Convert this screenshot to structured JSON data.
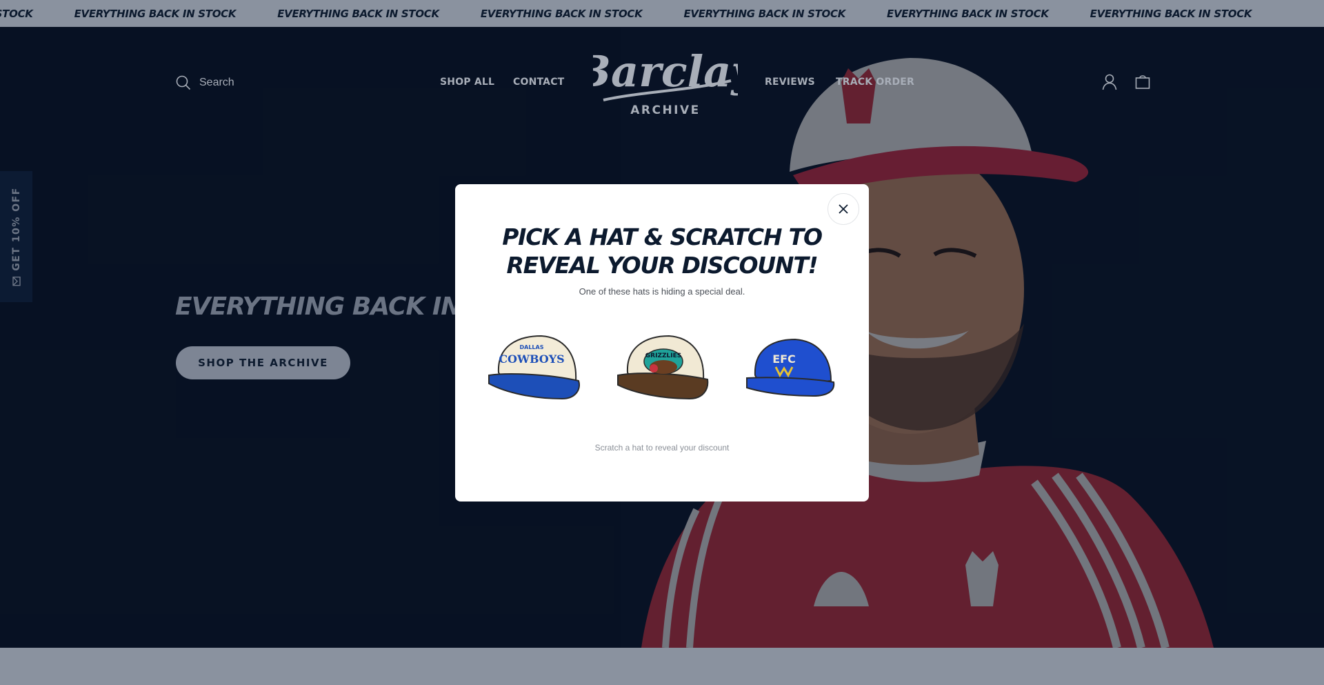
{
  "announcement": {
    "items": [
      "EVERYTHING BACK IN STOCK",
      "EVERYTHING BACK IN STOCK",
      "EVERYTHING BACK IN STOCK",
      "EVERYTHING BACK IN STOCK",
      "EVERYTHING BACK IN STOCK",
      "EVERYTHING BACK IN STOCK",
      "EVERYTHING BACK IN STOCK"
    ]
  },
  "header": {
    "search_label": "Search",
    "nav_left": [
      "SHOP ALL",
      "CONTACT"
    ],
    "nav_right": [
      "REVIEWS",
      "TRACK ORDER"
    ],
    "logo_script": "Barclay",
    "logo_sub": "ARCHIVE"
  },
  "side_tab": {
    "label": "GET 10% OFF"
  },
  "hero": {
    "heading": "EVERYTHING BACK IN STOCK",
    "button_label": "SHOP THE ARCHIVE"
  },
  "modal": {
    "title_line1": "PICK A HAT & SCRATCH TO",
    "title_line2": "REVEAL YOUR DISCOUNT!",
    "subtitle": "One of these hats is hiding a special deal.",
    "hint": "Scratch a hat to reveal your discount",
    "hats": [
      {
        "name": "Dallas Cowboys hat",
        "text": "COWBOYS",
        "top_text": "DALLAS",
        "crown": "#f3ecd8",
        "brim": "#1d4fb8"
      },
      {
        "name": "Vancouver Grizzlies hat",
        "text": "GRIZZLIES",
        "crown": "#f1e9d4",
        "brim": "#5a3b22"
      },
      {
        "name": "Everton hat",
        "text": "EFC",
        "crown": "#1f4fcf",
        "brim": "#1f4fcf"
      }
    ]
  },
  "colors": {
    "navy": "#0c1a2e",
    "overlay_gray": "#8a929f"
  }
}
